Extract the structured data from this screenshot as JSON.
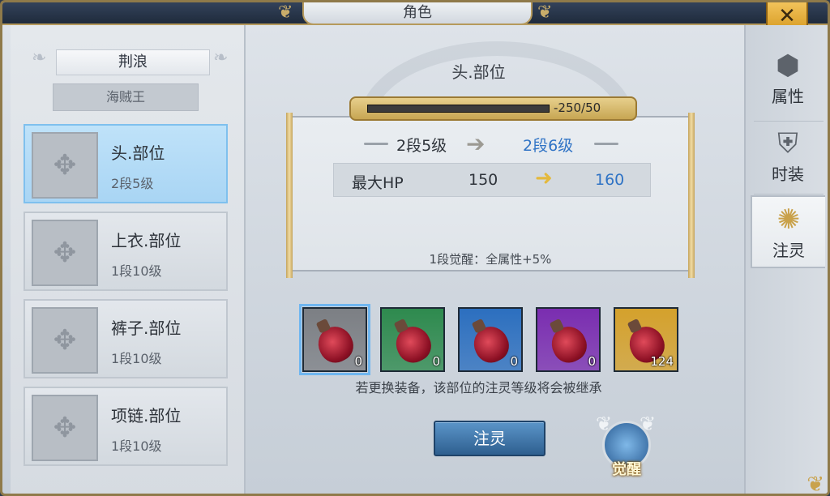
{
  "window": {
    "title": "角色",
    "close_glyph": "✕"
  },
  "character": {
    "name": "荆浪",
    "title": "海贼王"
  },
  "slots": [
    {
      "name": "头.部位",
      "level": "2段5级"
    },
    {
      "name": "上衣.部位",
      "level": "1段10级"
    },
    {
      "name": "裤子.部位",
      "level": "1段10级"
    },
    {
      "name": "项链.部位",
      "level": "1段10级"
    }
  ],
  "detail": {
    "heading": "头.部位",
    "progress_text": "-250/50",
    "level_from": "2段5级",
    "level_to": "2段6级",
    "stat_name": "最大HP",
    "stat_from": "150",
    "stat_to": "160",
    "awaken_note": "1段觉醒：全属性+5%"
  },
  "items": [
    {
      "color": "#7c7f84",
      "count": "0"
    },
    {
      "color": "#2e8a4e",
      "count": "0"
    },
    {
      "color": "#2c6fbf",
      "count": "0"
    },
    {
      "color": "#7a2db0",
      "count": "0"
    },
    {
      "color": "#d4a12c",
      "count": "124"
    }
  ],
  "inherit_note": "若更换装备，该部位的注灵等级将会被继承",
  "action_button": "注灵",
  "awaken_button": "觉醒",
  "tabs": [
    {
      "label": "属性",
      "icon": "attribute-icon"
    },
    {
      "label": "时装",
      "icon": "costume-icon"
    },
    {
      "label": "注灵",
      "icon": "infuse-icon"
    }
  ],
  "colors": {
    "accent_blue": "#2f73c5",
    "gold": "#c9a14a",
    "selected_blue": "#7fc0ee"
  }
}
